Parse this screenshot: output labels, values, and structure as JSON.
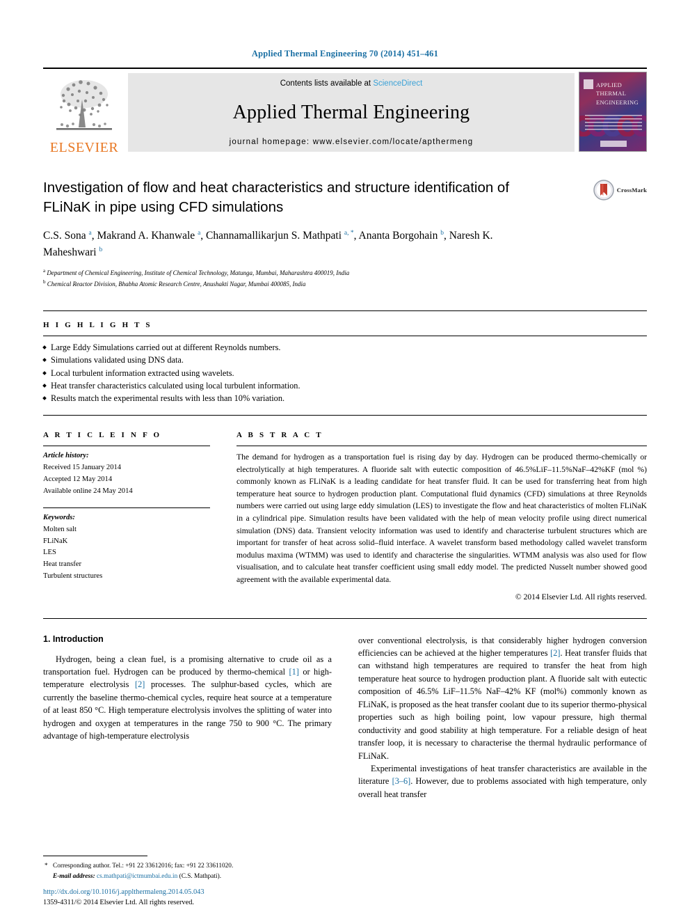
{
  "running_head": "Applied Thermal Engineering 70 (2014) 451–461",
  "masthead": {
    "publisher": "ELSEVIER",
    "contents_prefix": "Contents lists available at ",
    "contents_link": "ScienceDirect",
    "journal_title": "Applied Thermal Engineering",
    "homepage_line": "journal homepage: www.elsevier.com/locate/apthermeng",
    "cover_title_line1": "APPLIED",
    "cover_title_line2": "THERMAL",
    "cover_title_line3": "ENGINEERING"
  },
  "article": {
    "title": "Investigation of flow and heat characteristics and structure identification of FLiNaK in pipe using CFD simulations",
    "crossmark_label": "CrossMark",
    "authors": [
      {
        "name": "C.S. Sona",
        "marks": "a"
      },
      {
        "name": "Makrand A. Khanwale",
        "marks": "a"
      },
      {
        "name": "Channamallikarjun S. Mathpati",
        "marks": "a, *"
      },
      {
        "name": "Ananta Borgohain",
        "marks": "b"
      },
      {
        "name": "Naresh K. Maheshwari",
        "marks": "b"
      }
    ],
    "affiliations": [
      {
        "mark": "a",
        "text": "Department of Chemical Engineering, Institute of Chemical Technology, Matunga, Mumbai, Maharashtra 400019, India"
      },
      {
        "mark": "b",
        "text": "Chemical Reactor Division, Bhabha Atomic Research Centre, Anushakti Nagar, Mumbai 400085, India"
      }
    ]
  },
  "highlights": {
    "heading": "H I G H L I G H T S",
    "items": [
      "Large Eddy Simulations carried out at different Reynolds numbers.",
      "Simulations validated using DNS data.",
      "Local turbulent information extracted using wavelets.",
      "Heat transfer characteristics calculated using local turbulent information.",
      "Results match the experimental results with less than 10% variation."
    ]
  },
  "article_info": {
    "heading": "A R T I C L E   I N F O",
    "history_label": "Article history:",
    "history": [
      "Received 15 January 2014",
      "Accepted 12 May 2014",
      "Available online 24 May 2014"
    ],
    "keywords_label": "Keywords:",
    "keywords": [
      "Molten salt",
      "FLiNaK",
      "LES",
      "Heat transfer",
      "Turbulent structures"
    ]
  },
  "abstract": {
    "heading": "A B S T R A C T",
    "text": "The demand for hydrogen as a transportation fuel is rising day by day. Hydrogen can be produced thermo-chemically or electrolytically at high temperatures. A fluoride salt with eutectic composition of 46.5%LiF–11.5%NaF–42%KF (mol %) commonly known as FLiNaK is a leading candidate for heat transfer fluid. It can be used for transferring heat from high temperature heat source to hydrogen production plant. Computational fluid dynamics (CFD) simulations at three Reynolds numbers were carried out using large eddy simulation (LES) to investigate the flow and heat characteristics of molten FLiNaK in a cylindrical pipe. Simulation results have been validated with the help of mean velocity profile using direct numerical simulation (DNS) data. Transient velocity information was used to identify and characterise turbulent structures which are important for transfer of heat across solid–fluid interface. A wavelet transform based methodology called wavelet transform modulus maxima (WTMM) was used to identify and characterise the singularities. WTMM analysis was also used for flow visualisation, and to calculate heat transfer coefficient using small eddy model. The predicted Nusselt number showed good agreement with the available experimental data.",
    "copyright": "© 2014 Elsevier Ltd. All rights reserved."
  },
  "introduction": {
    "number_title": "1. Introduction",
    "left_para": "Hydrogen, being a clean fuel, is a promising alternative to crude oil as a transportation fuel. Hydrogen can be produced by thermo-chemical [1] or high-temperature electrolysis [2] processes. The sulphur-based cycles, which are currently the baseline thermo-chemical cycles, require heat source at a temperature of at least 850 °C. High temperature electrolysis involves the splitting of water into hydrogen and oxygen at temperatures in the range 750 to 900 °C. The primary advantage of high-temperature electrolysis",
    "right_para_1": "over conventional electrolysis, is that considerably higher hydrogen conversion efficiencies can be achieved at the higher temperatures [2]. Heat transfer fluids that can withstand high temperatures are required to transfer the heat from high temperature heat source to hydrogen production plant. A fluoride salt with eutectic composition of 46.5% LiF–11.5% NaF–42% KF (mol%) commonly known as FLiNaK, is proposed as the heat transfer coolant due to its superior thermo-physical properties such as high boiling point, low vapour pressure, high thermal conductivity and good stability at high temperature. For a reliable design of heat transfer loop, it is necessary to characterise the thermal hydraulic performance of FLiNaK.",
    "right_para_2": "Experimental investigations of heat transfer characteristics are available in the literature [3–6]. However, due to problems associated with high temperature, only overall heat transfer"
  },
  "footer": {
    "corresponding_note": "Corresponding author. Tel.: +91 22 33612016; fax: +91 22 33611020.",
    "email_label": "E-mail address:",
    "email": "cs.mathpati@ictmumbai.edu.in",
    "email_suffix": "(C.S. Mathpati).",
    "doi": "http://dx.doi.org/10.1016/j.applthermaleng.2014.05.043",
    "issn_line": "1359-4311/© 2014 Elsevier Ltd. All rights reserved."
  },
  "colors": {
    "link": "#1a6fa3",
    "sciencedirect": "#3aa1d6",
    "elsevier_orange": "#E87722"
  }
}
